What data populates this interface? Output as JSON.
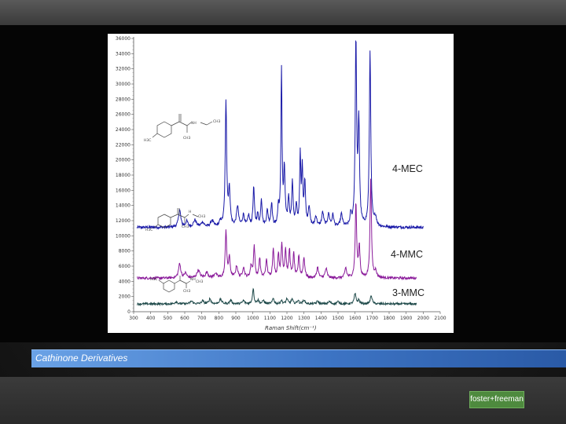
{
  "caption": "Cathinone Derivatives",
  "logo_text": "foster+freeman",
  "structure_labels": {
    "mec_ch3_left": "H3C",
    "mec_nh": "NH",
    "mec_ch3_right": "CH3",
    "mec_ch3_bottom": "CH3",
    "mmc_ch3_left": "H3C",
    "mmc_nh": "H",
    "mmc_ch3_right": "CH3",
    "mmc_ch3_bottom": "CH3",
    "mmc3_ch3_left": "H3C",
    "mmc3_nh": "NH",
    "mmc3_ch3_right": "CH3",
    "mmc3_ch3_bottom": "CH3"
  },
  "colors": {
    "mec": "#1a1aa8",
    "mmc": "#8a1a9a",
    "mmc3": "#1f4a4a",
    "caption_bar": "#3d74c4",
    "logo": "#4e8a3e"
  },
  "chart_data": {
    "type": "line",
    "title": "",
    "xlabel": "Raman Shift(cm⁻¹)",
    "ylabel": "",
    "xlim": [
      300,
      2100
    ],
    "ylim": [
      0,
      35000
    ],
    "x_ticks": [
      300,
      400,
      500,
      600,
      700,
      800,
      900,
      1000,
      1100,
      1200,
      1300,
      1400,
      1500,
      1600,
      1700,
      1800,
      1900,
      2000,
      2100
    ],
    "y_ticks": [
      0,
      2000,
      4000,
      6000,
      8000,
      10000,
      12000,
      14000,
      16000,
      18000,
      20000,
      22000,
      24000,
      26000,
      28000,
      30000,
      32000,
      34000,
      36000
    ],
    "series": [
      {
        "name": "4-MEC",
        "baseline": 10800,
        "noise": 350,
        "peaks": [
          [
            570,
            2200,
            8
          ],
          [
            612,
            700,
            8
          ],
          [
            660,
            900,
            10
          ],
          [
            705,
            600,
            10
          ],
          [
            760,
            800,
            10
          ],
          [
            810,
            600,
            8
          ],
          [
            842,
            16000,
            5
          ],
          [
            862,
            4500,
            6
          ],
          [
            910,
            2600,
            7
          ],
          [
            945,
            1500,
            7
          ],
          [
            975,
            1400,
            6
          ],
          [
            1005,
            5000,
            5
          ],
          [
            1028,
            1500,
            5
          ],
          [
            1050,
            3500,
            5
          ],
          [
            1085,
            2000,
            6
          ],
          [
            1110,
            3000,
            5
          ],
          [
            1150,
            2300,
            5
          ],
          [
            1168,
            20000,
            4
          ],
          [
            1185,
            7000,
            5
          ],
          [
            1210,
            3500,
            5
          ],
          [
            1232,
            5500,
            5
          ],
          [
            1255,
            2500,
            5
          ],
          [
            1278,
            9000,
            4
          ],
          [
            1290,
            7200,
            4
          ],
          [
            1305,
            5500,
            5
          ],
          [
            1330,
            2500,
            6
          ],
          [
            1370,
            1300,
            7
          ],
          [
            1410,
            1800,
            7
          ],
          [
            1445,
            1600,
            7
          ],
          [
            1470,
            1500,
            6
          ],
          [
            1520,
            1600,
            7
          ],
          [
            1575,
            1400,
            5
          ],
          [
            1605,
            23500,
            5
          ],
          [
            1622,
            13000,
            5
          ],
          [
            1688,
            22500,
            5
          ],
          [
            1720,
            1100,
            8
          ]
        ]
      },
      {
        "name": "4-MMC",
        "baseline": 4300,
        "noise": 320,
        "peaks": [
          [
            570,
            1800,
            8
          ],
          [
            605,
            600,
            8
          ],
          [
            680,
            1000,
            10
          ],
          [
            730,
            700,
            9
          ],
          [
            780,
            600,
            9
          ],
          [
            842,
            6000,
            5
          ],
          [
            862,
            2500,
            6
          ],
          [
            905,
            1500,
            7
          ],
          [
            945,
            1300,
            7
          ],
          [
            990,
            1500,
            6
          ],
          [
            1008,
            4000,
            5
          ],
          [
            1040,
            2500,
            5
          ],
          [
            1080,
            2200,
            6
          ],
          [
            1120,
            3800,
            5
          ],
          [
            1150,
            3000,
            5
          ],
          [
            1170,
            4200,
            5
          ],
          [
            1192,
            3500,
            5
          ],
          [
            1215,
            3500,
            5
          ],
          [
            1240,
            3000,
            5
          ],
          [
            1270,
            2800,
            5
          ],
          [
            1300,
            2500,
            6
          ],
          [
            1380,
            1400,
            6
          ],
          [
            1430,
            1200,
            7
          ],
          [
            1545,
            1300,
            6
          ],
          [
            1605,
            9500,
            5
          ],
          [
            1625,
            4000,
            5
          ],
          [
            1692,
            12500,
            5
          ],
          [
            1720,
            800,
            8
          ]
        ]
      },
      {
        "name": "3-MMC",
        "baseline": 1000,
        "noise": 260,
        "peaks": [
          [
            550,
            300,
            8
          ],
          [
            640,
            350,
            9
          ],
          [
            705,
            400,
            8
          ],
          [
            748,
            650,
            7
          ],
          [
            810,
            600,
            8
          ],
          [
            870,
            500,
            7
          ],
          [
            945,
            400,
            8
          ],
          [
            1002,
            2000,
            5
          ],
          [
            1030,
            500,
            6
          ],
          [
            1062,
            450,
            6
          ],
          [
            1120,
            700,
            6
          ],
          [
            1168,
            450,
            6
          ],
          [
            1200,
            650,
            6
          ],
          [
            1230,
            600,
            6
          ],
          [
            1265,
            450,
            6
          ],
          [
            1300,
            500,
            7
          ],
          [
            1380,
            350,
            7
          ],
          [
            1450,
            300,
            7
          ],
          [
            1500,
            300,
            7
          ],
          [
            1600,
            1300,
            6
          ],
          [
            1622,
            500,
            6
          ],
          [
            1695,
            1100,
            6
          ]
        ]
      }
    ]
  }
}
